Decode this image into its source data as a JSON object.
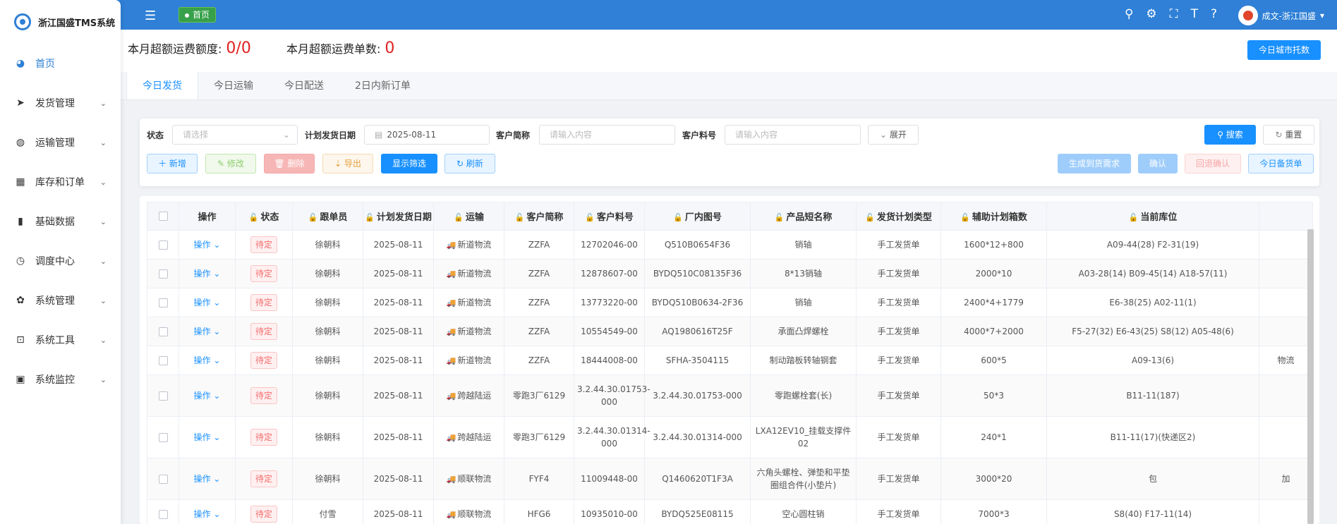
{
  "app": {
    "title": "浙江国盛TMS系统"
  },
  "sidebar": {
    "items": [
      {
        "label": "首页",
        "icon": "dashboard-icon",
        "glyph": "◕"
      },
      {
        "label": "发货管理",
        "icon": "send-icon",
        "glyph": "➤"
      },
      {
        "label": "运输管理",
        "icon": "globe-icon",
        "glyph": "◍"
      },
      {
        "label": "库存和订单",
        "icon": "grid-icon",
        "glyph": "▦"
      },
      {
        "label": "基础数据",
        "icon": "book-icon",
        "glyph": "▮"
      },
      {
        "label": "调度中心",
        "icon": "clock-icon",
        "glyph": "◷"
      },
      {
        "label": "系统管理",
        "icon": "gear-icon",
        "glyph": "✿"
      },
      {
        "label": "系统工具",
        "icon": "toolbox-icon",
        "glyph": "⊡"
      },
      {
        "label": "系统监控",
        "icon": "monitor-icon",
        "glyph": "▣"
      }
    ]
  },
  "header": {
    "home_tag": "首页",
    "user": "成文-浙江国盛"
  },
  "summary": {
    "amount_label": "本月超额运费额度:",
    "amount_value": "0/0",
    "count_label": "本月超额运费单数:",
    "count_value": "0",
    "city_button": "今日城市托数"
  },
  "tabs": [
    "今日发货",
    "今日运输",
    "今日配送",
    "2日内新订单"
  ],
  "filters": {
    "status_label": "状态",
    "status_placeholder": "请选择",
    "date_label": "计划发货日期",
    "date_value": "2025-08-11",
    "customer_label": "客户简称",
    "customer_placeholder": "请输入内容",
    "part_label": "客户料号",
    "part_placeholder": "请输入内容",
    "expand": "展开",
    "search": "搜索",
    "reset": "重置"
  },
  "toolbar": {
    "add": "新增",
    "edit": "修改",
    "delete": "删除",
    "export": "导出",
    "show_filter": "显示筛选",
    "refresh": "刷新",
    "gen_demand": "生成到货需求",
    "confirm": "确认",
    "rollback": "回退确认",
    "today_stock": "今日备货单"
  },
  "table": {
    "headers": [
      "操作",
      "状态",
      "跟单员",
      "计划发货日期",
      "运输",
      "客户简称",
      "客户料号",
      "厂内图号",
      "产品短名称",
      "发货计划类型",
      "辅助计划箱数",
      "当前库位"
    ],
    "op_label": "操作",
    "rows": [
      {
        "status": "待定",
        "follower": "徐朝科",
        "date": "2025-08-11",
        "transport": "新道物流",
        "customer": "ZZFA",
        "part": "12702046-00",
        "drawing": "Q510B0654F36",
        "product": "销轴",
        "plan_type": "手工发货单",
        "boxes": "1600*12+800",
        "location": "A09-44(28) F2-31(19)",
        "extra": ""
      },
      {
        "status": "待定",
        "follower": "徐朝科",
        "date": "2025-08-11",
        "transport": "新道物流",
        "customer": "ZZFA",
        "part": "12878607-00",
        "drawing": "BYDQ510C08135F36",
        "product": "8*13销轴",
        "plan_type": "手工发货单",
        "boxes": "2000*10",
        "location": "A03-28(14) B09-45(14) A18-57(11)",
        "extra": ""
      },
      {
        "status": "待定",
        "follower": "徐朝科",
        "date": "2025-08-11",
        "transport": "新道物流",
        "customer": "ZZFA",
        "part": "13773220-00",
        "drawing": "BYDQ510B0634-2F36",
        "product": "销轴",
        "plan_type": "手工发货单",
        "boxes": "2400*4+1779",
        "location": "E6-38(25) A02-11(1)",
        "extra": ""
      },
      {
        "status": "待定",
        "follower": "徐朝科",
        "date": "2025-08-11",
        "transport": "新道物流",
        "customer": "ZZFA",
        "part": "10554549-00",
        "drawing": "AQ1980616T25F",
        "product": "承面凸焊螺栓",
        "plan_type": "手工发货单",
        "boxes": "4000*7+2000",
        "location": "F5-27(32) E6-43(25) S8(12) A05-48(6)",
        "extra": ""
      },
      {
        "status": "待定",
        "follower": "徐朝科",
        "date": "2025-08-11",
        "transport": "新道物流",
        "customer": "ZZFA",
        "part": "18444008-00",
        "drawing": "SFHA-3504115",
        "product": "制动踏板转轴钢套",
        "plan_type": "手工发货单",
        "boxes": "600*5",
        "location": "A09-13(6)",
        "extra": "物流"
      },
      {
        "status": "待定",
        "follower": "徐朝科",
        "date": "2025-08-11",
        "transport": "跨越陆运",
        "customer": "零跑3厂6129",
        "part": "3.2.44.30.01753-000",
        "drawing": "3.2.44.30.01753-000",
        "product": "零跑螺栓套(长)",
        "plan_type": "手工发货单",
        "boxes": "50*3",
        "location": "B11-11(187)",
        "extra": ""
      },
      {
        "status": "待定",
        "follower": "徐朝科",
        "date": "2025-08-11",
        "transport": "跨越陆运",
        "customer": "零跑3厂6129",
        "part": "3.2.44.30.01314-000",
        "drawing": "3.2.44.30.01314-000",
        "product": "LXA12EV10_挂载支撑件02",
        "plan_type": "手工发货单",
        "boxes": "240*1",
        "location": "B11-11(17)(快递区2)",
        "extra": ""
      },
      {
        "status": "待定",
        "follower": "徐朝科",
        "date": "2025-08-11",
        "transport": "顺联物流",
        "customer": "FYF4",
        "part": "11009448-00",
        "drawing": "Q1460620T1F3A",
        "product": "六角头螺栓、弹垫和平垫圈组合件(小垫片)",
        "plan_type": "手工发货单",
        "boxes": "3000*20",
        "location": "包",
        "extra": "加"
      },
      {
        "status": "待定",
        "follower": "付雪",
        "date": "2025-08-11",
        "transport": "顺联物流",
        "customer": "HFG6",
        "part": "10935010-00",
        "drawing": "BYDQ525E08115",
        "product": "空心圆柱销",
        "plan_type": "手工发货单",
        "boxes": "7000*3",
        "location": "S8(40) F17-11(14)",
        "extra": ""
      }
    ]
  }
}
